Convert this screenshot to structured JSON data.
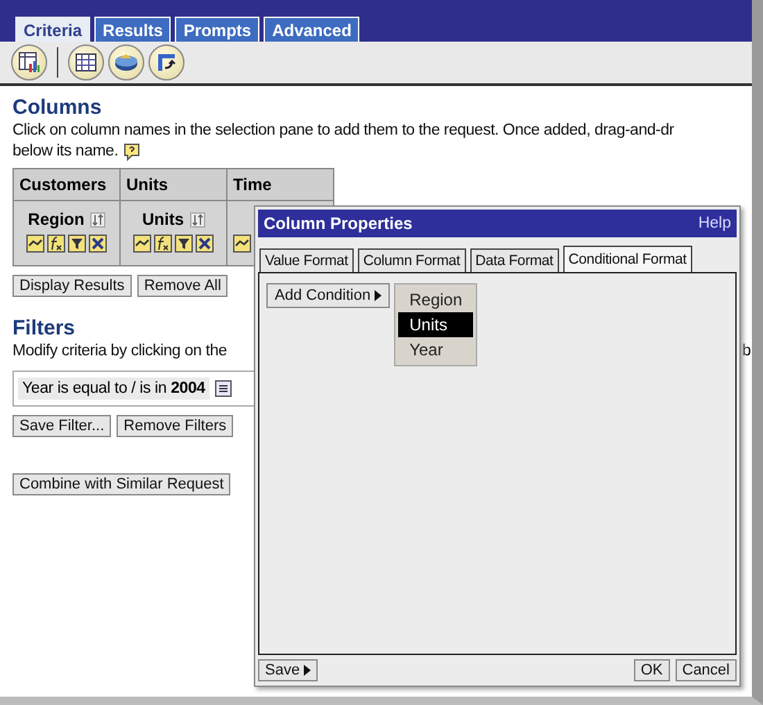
{
  "tabs": [
    {
      "label": "Criteria",
      "selected": true
    },
    {
      "label": "Results",
      "selected": false
    },
    {
      "label": "Prompts",
      "selected": false
    },
    {
      "label": "Advanced",
      "selected": false
    }
  ],
  "columns_section": {
    "title": "Columns",
    "lines": [
      "Click on column names in the selection pane to add them to the request. Once added, drag-and-dr",
      "below its name."
    ],
    "groups": [
      {
        "heading": "Customers",
        "column": "Region"
      },
      {
        "heading": "Units",
        "column": "Units"
      },
      {
        "heading": "Time"
      }
    ],
    "buttons": [
      "Display Results",
      "Remove All"
    ]
  },
  "filters": {
    "title": "Filters",
    "description": "Modify criteria by clicking on the",
    "description_tail": "b",
    "items": [
      {
        "text": "Year is equal to / is in **2004**"
      }
    ],
    "buttons": [
      "Save Filter...",
      "Remove Filters"
    ]
  },
  "combine_button": "Combine with Similar Request",
  "dialog": {
    "title": "Column Properties",
    "help": "Help",
    "tabs": [
      {
        "label": "Value Format",
        "selected": false
      },
      {
        "label": "Column Format",
        "selected": false
      },
      {
        "label": "Data Format",
        "selected": false
      },
      {
        "label": "Conditional Format",
        "selected": true
      }
    ],
    "add_condition": "Add Condition",
    "menu": [
      {
        "label": "Region",
        "selected": false
      },
      {
        "label": "Units",
        "selected": true
      },
      {
        "label": "Year",
        "selected": false
      }
    ],
    "save": "Save",
    "buttons": [
      "OK",
      "Cancel"
    ]
  }
}
